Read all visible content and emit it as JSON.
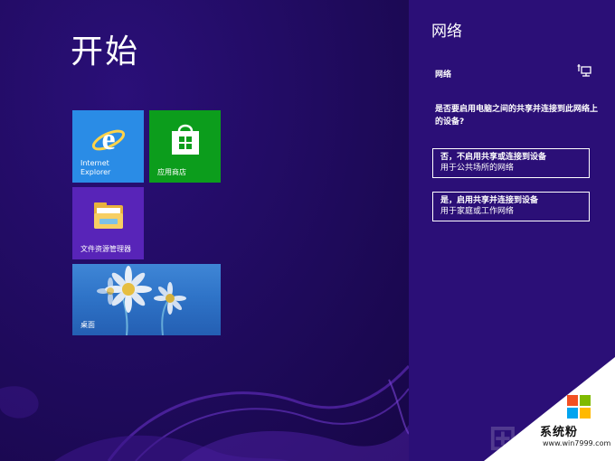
{
  "start": {
    "title": "开始",
    "tiles": {
      "ie": "Internet\nExplorer",
      "store": "应用商店",
      "explorer": "文件资源管理器",
      "desktop": "桌面"
    }
  },
  "network_charm": {
    "title": "网络",
    "section": "网络",
    "question": "是否要启用电脑之间的共享并连接到此网络上的设备?",
    "option_no": {
      "title": "否，不启用共享或连接到设备",
      "subtitle": "用于公共场所的网络"
    },
    "option_yes": {
      "title": "是，启用共享并连接到设备",
      "subtitle": "用于家庭或工作网络"
    }
  },
  "watermark": {
    "name": "系统粉",
    "url": "www.win7999.com"
  },
  "colors": {
    "background": "#1f0a5c",
    "charm": "#2b0f77",
    "ie_tile": "#2a8ce6",
    "store_tile": "#0c9d1c",
    "explorer_tile": "#5824b8"
  }
}
